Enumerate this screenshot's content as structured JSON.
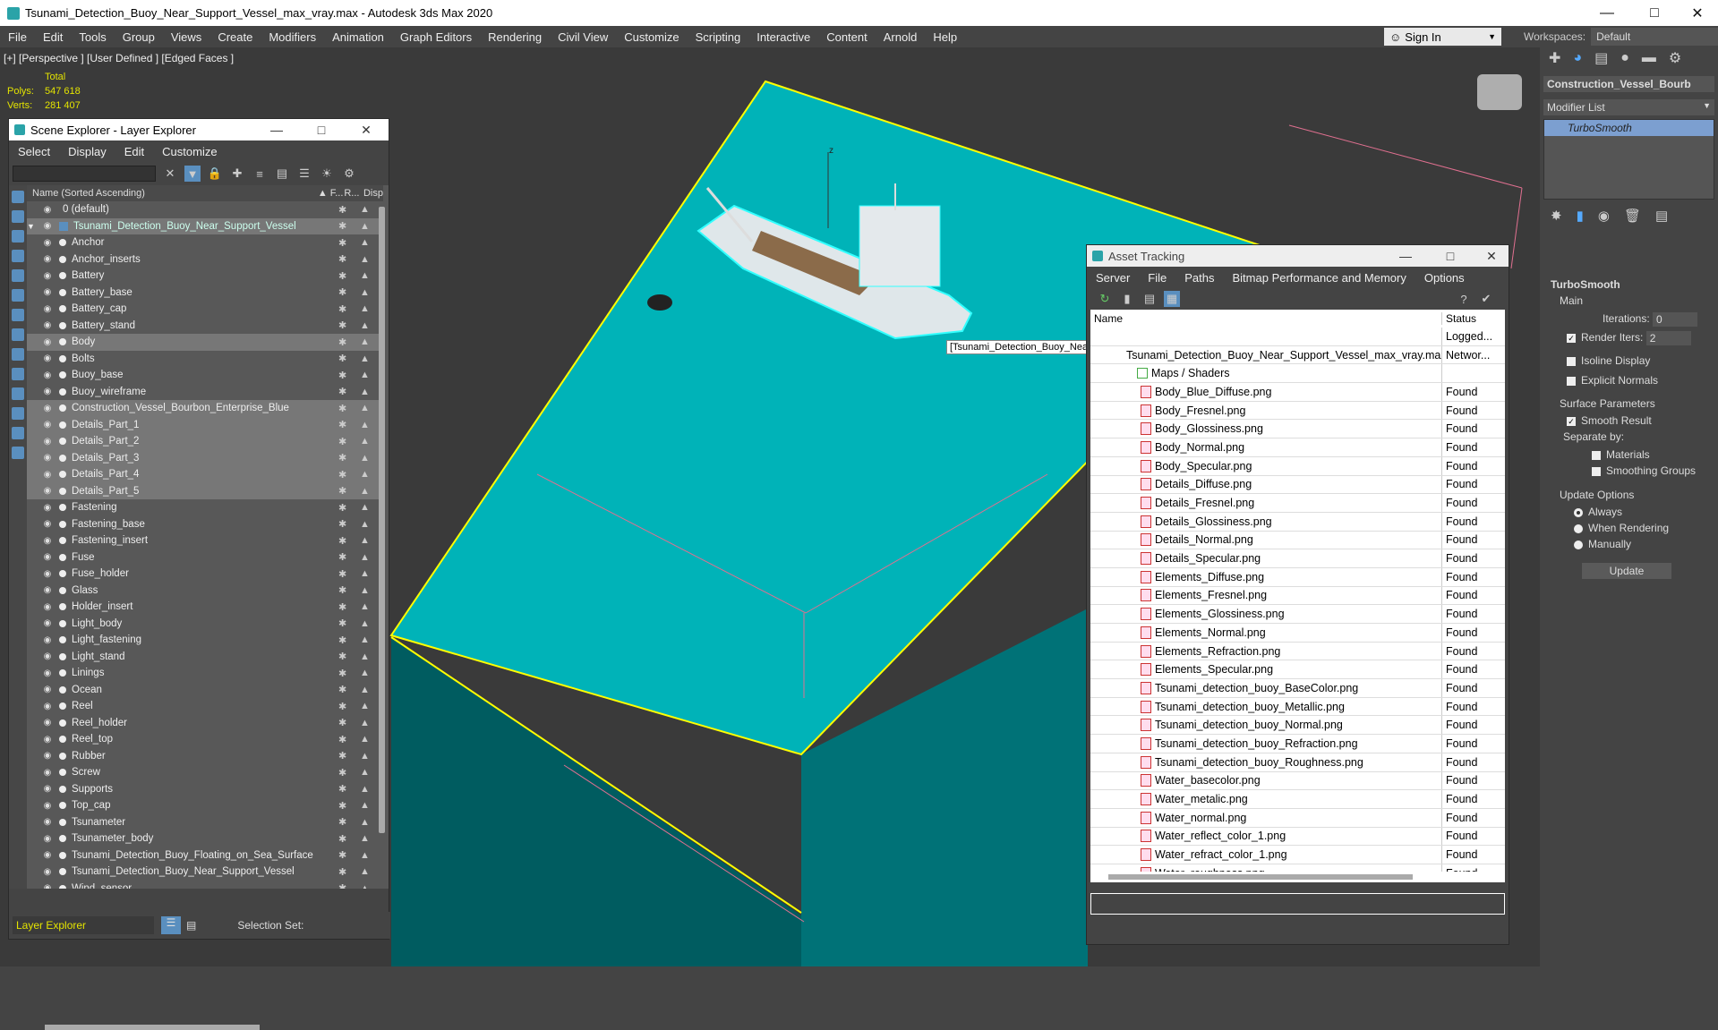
{
  "window": {
    "title": "Tsunami_Detection_Buoy_Near_Support_Vessel_max_vray.max - Autodesk 3ds Max 2020"
  },
  "menu": [
    "File",
    "Edit",
    "Tools",
    "Group",
    "Views",
    "Create",
    "Modifiers",
    "Animation",
    "Graph Editors",
    "Rendering",
    "Civil View",
    "Customize",
    "Scripting",
    "Interactive",
    "Content",
    "Arnold",
    "Help"
  ],
  "signin": "Sign In",
  "workspaces": {
    "label": "Workspaces:",
    "value": "Default"
  },
  "viewport": {
    "label": "[+] [Perspective ] [User Defined ] [Edged Faces ]",
    "stats_total": "Total",
    "polys_label": "Polys:",
    "polys": "547 618",
    "verts_label": "Verts:",
    "verts": "281 407",
    "tooltip": "[Tsunami_Detection_Buoy_Near_Support_Vessel] Ocean",
    "axis_z": "z"
  },
  "scene_explorer": {
    "title": "Scene Explorer - Layer Explorer",
    "menu": [
      "Select",
      "Display",
      "Edit",
      "Customize"
    ],
    "col_name": "Name (Sorted Ascending)",
    "col_f": "▲ F...",
    "col_r": "R...",
    "col_d": "Disp",
    "layer_default": "0 (default)",
    "layer_main": "Tsunami_Detection_Buoy_Near_Support_Vessel",
    "items": [
      "Anchor",
      "Anchor_inserts",
      "Battery",
      "Battery_base",
      "Battery_cap",
      "Battery_stand",
      "Body",
      "Bolts",
      "Buoy_base",
      "Buoy_wireframe",
      "Construction_Vessel_Bourbon_Enterprise_Blue",
      "Details_Part_1",
      "Details_Part_2",
      "Details_Part_3",
      "Details_Part_4",
      "Details_Part_5",
      "Fastening",
      "Fastening_base",
      "Fastening_insert",
      "Fuse",
      "Fuse_holder",
      "Glass",
      "Holder_insert",
      "Light_body",
      "Light_fastening",
      "Light_stand",
      "Linings",
      "Ocean",
      "Reel",
      "Reel_holder",
      "Reel_top",
      "Rubber",
      "Screw",
      "Supports",
      "Top_cap",
      "Tsunameter",
      "Tsunameter_body",
      "Tsunami_Detection_Buoy_Floating_on_Sea_Surface",
      "Tsunami_Detection_Buoy_Near_Support_Vessel",
      "Wind_sensor"
    ],
    "footer_layer": "Layer Explorer",
    "footer_selset": "Selection Set:"
  },
  "asset_tracking": {
    "title": "Asset Tracking",
    "menu": [
      "Server",
      "File",
      "Paths",
      "Bitmap Performance and Memory",
      "Options"
    ],
    "col_name": "Name",
    "col_status": "Status",
    "root": {
      "name": "",
      "status": "Logged..."
    },
    "file": {
      "name": "Tsunami_Detection_Buoy_Near_Support_Vessel_max_vray.max",
      "status": "Networ..."
    },
    "group": "Maps / Shaders",
    "maps": [
      "Body_Blue_Diffuse.png",
      "Body_Fresnel.png",
      "Body_Glossiness.png",
      "Body_Normal.png",
      "Body_Specular.png",
      "Details_Diffuse.png",
      "Details_Fresnel.png",
      "Details_Glossiness.png",
      "Details_Normal.png",
      "Details_Specular.png",
      "Elements_Diffuse.png",
      "Elements_Fresnel.png",
      "Elements_Glossiness.png",
      "Elements_Normal.png",
      "Elements_Refraction.png",
      "Elements_Specular.png",
      "Tsunami_detection_buoy_BaseColor.png",
      "Tsunami_detection_buoy_Metallic.png",
      "Tsunami_detection_buoy_Normal.png",
      "Tsunami_detection_buoy_Refraction.png",
      "Tsunami_detection_buoy_Roughness.png",
      "Water_basecolor.png",
      "Water_metalic.png",
      "Water_normal.png",
      "Water_reflect_color_1.png",
      "Water_refract_color_1.png",
      "Water_roughness.png"
    ],
    "found": "Found"
  },
  "command_panel": {
    "object_name": "Construction_Vessel_Bourb",
    "modifier_list": "Modifier List",
    "modifier": "TurboSmooth",
    "rollout": "TurboSmooth",
    "main": "Main",
    "iterations_label": "Iterations:",
    "iterations": "0",
    "render_iters_label": "Render Iters:",
    "render_iters": "2",
    "isoline": "Isoline Display",
    "explicit": "Explicit Normals",
    "surface": "Surface Parameters",
    "smooth_result": "Smooth Result",
    "separate_by": "Separate by:",
    "materials": "Materials",
    "smoothing_groups": "Smoothing Groups",
    "update_options": "Update Options",
    "always": "Always",
    "when_rendering": "When Rendering",
    "manually": "Manually",
    "update": "Update"
  },
  "colors": {
    "ocean": "#00b3b8",
    "ocean_side": "#005c60",
    "selection": "#ffff00",
    "accent": "#2aa3a8"
  }
}
